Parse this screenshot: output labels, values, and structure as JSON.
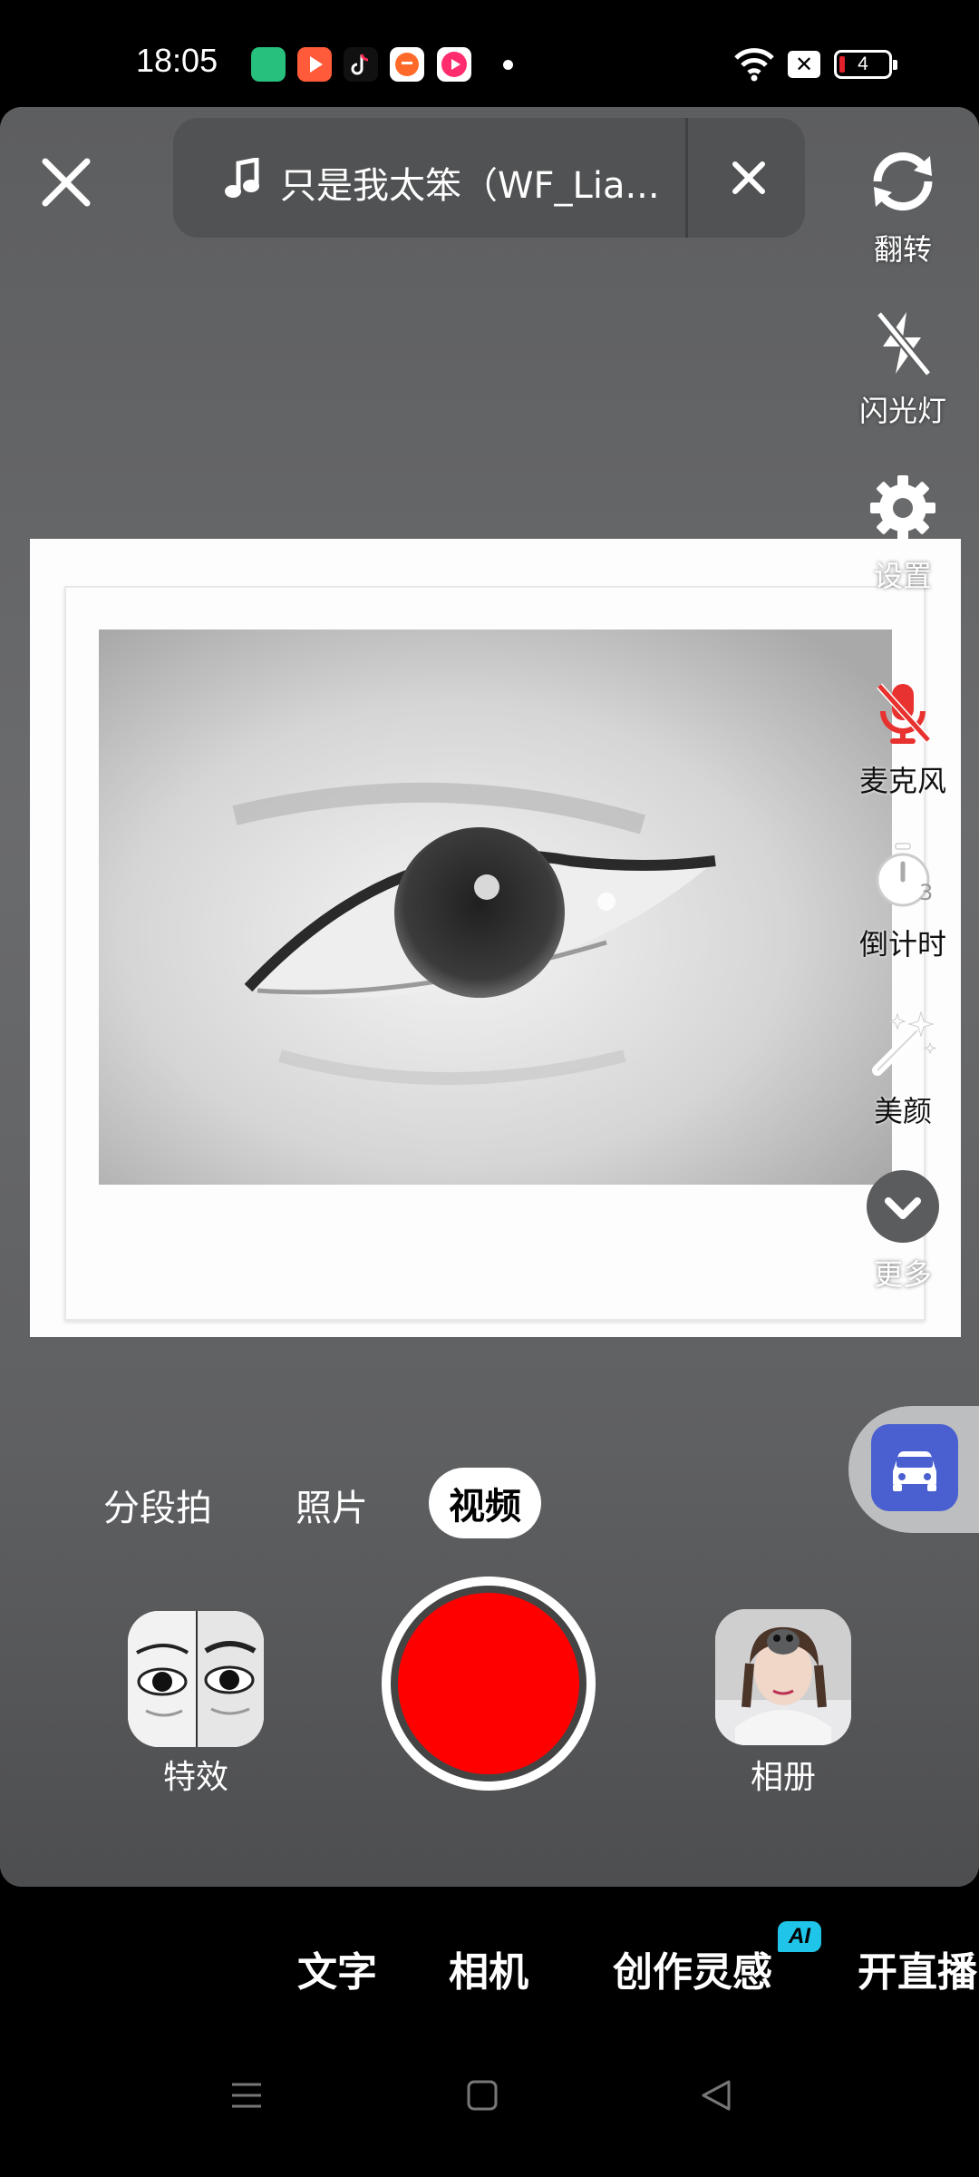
{
  "status_bar": {
    "time": "18:05",
    "battery": "4",
    "app_icons": [
      {
        "icon": "phone-manager-icon",
        "color": "#27c07d"
      },
      {
        "icon": "video-player-icon",
        "color": "#ff5a3a"
      },
      {
        "icon": "tiktok-icon",
        "color": "#111111"
      },
      {
        "icon": "shopping-icon",
        "color": "#ff6a2a"
      },
      {
        "icon": "music-app-icon",
        "color": "#ff2d6e"
      }
    ]
  },
  "top_bar": {
    "music_title": "只是我太笨（WF_Lia..."
  },
  "side_tools": [
    {
      "icon": "flip-camera-icon",
      "label": "翻转"
    },
    {
      "icon": "flash-off-icon",
      "label": "闪光灯"
    },
    {
      "icon": "settings-icon",
      "label": "设置"
    },
    {
      "icon": "microphone-off-icon",
      "label": "麦克风"
    },
    {
      "icon": "timer-icon",
      "label": "倒计时"
    },
    {
      "icon": "beauty-wand-icon",
      "label": "美颜"
    },
    {
      "icon": "chevron-down-icon",
      "label": "更多"
    }
  ],
  "timer_badge": "3",
  "capture_modes": {
    "items": [
      "分段拍",
      "照片",
      "视频"
    ],
    "selected": "视频"
  },
  "bottom_actions": {
    "effects_label": "特效",
    "album_label": "相册"
  },
  "tabs": {
    "items": [
      "文字",
      "相机",
      "创作灵感",
      "开直播"
    ],
    "ai_badge": "AI"
  },
  "colors": {
    "shutter": "#ff0000",
    "mic_off": "#e8322f",
    "car_button": "#4a5fd0",
    "ai_badge": "#1fc5e8"
  }
}
